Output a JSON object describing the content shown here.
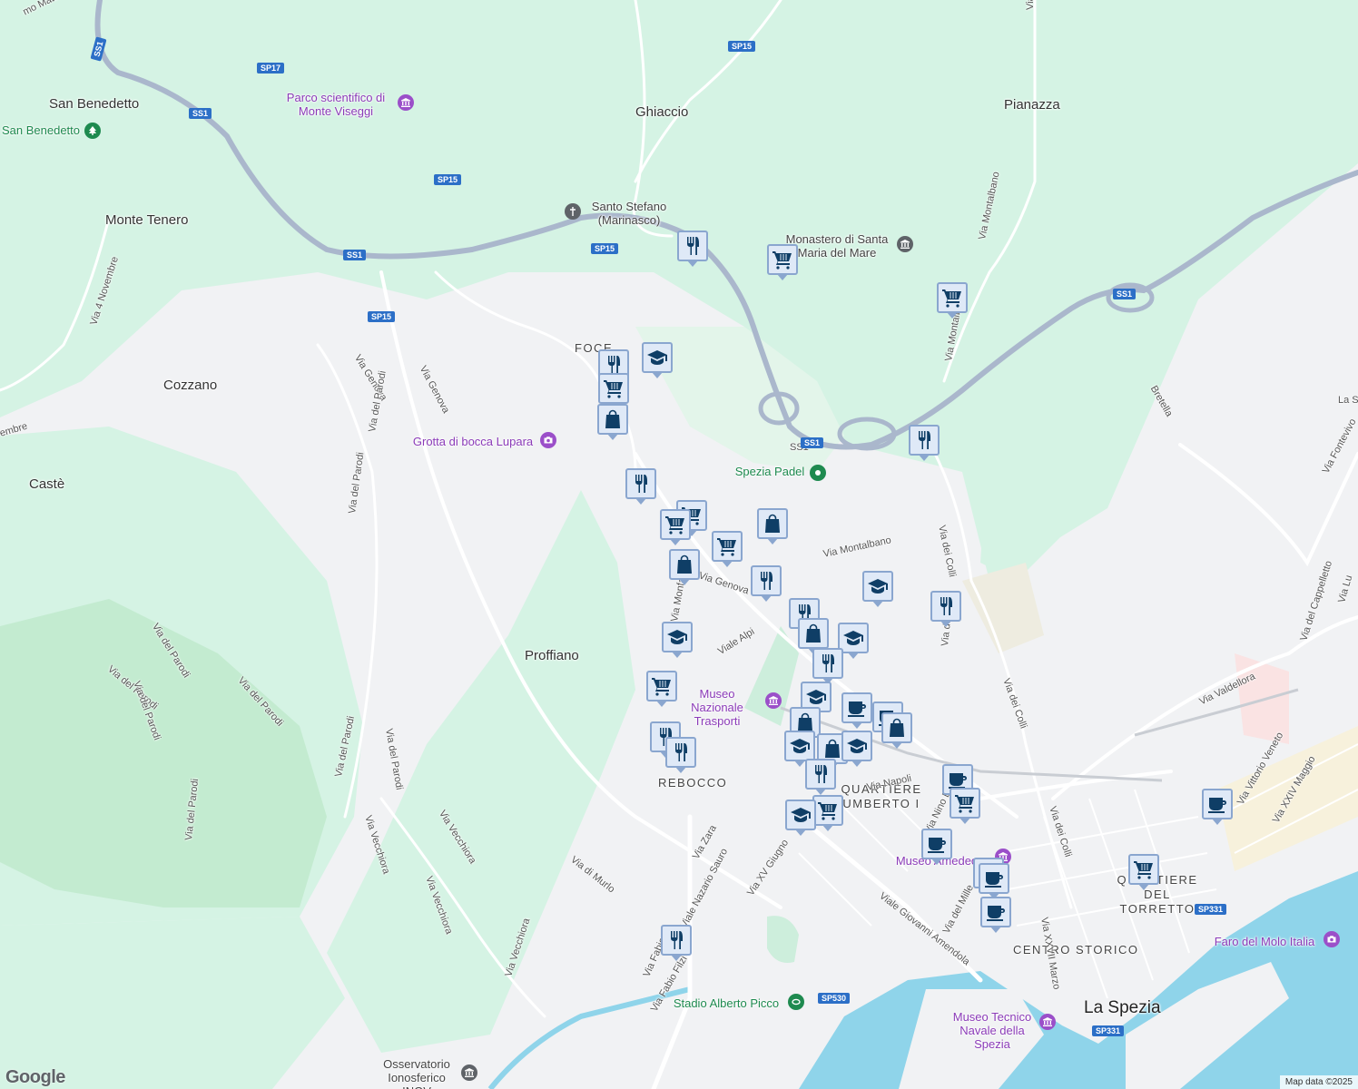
{
  "places": [
    {
      "text": "San Benedetto"
    },
    {
      "text": "Ghiaccio"
    },
    {
      "text": "Pianazza"
    },
    {
      "text": "Monte Tenero"
    },
    {
      "text": "Cozzano"
    },
    {
      "text": "Castè"
    },
    {
      "text": "Proffiano"
    },
    {
      "text": "FOCE"
    },
    {
      "text": "REBOCCO"
    },
    {
      "text": "QUARTIERE UMBERTO I"
    },
    {
      "text": "QUARTIERE DEL TORRETTO"
    },
    {
      "text": "CENTRO STORICO"
    },
    {
      "text": "La Spezia"
    }
  ],
  "pois": [
    {
      "text": "Parco scientifico di Monte Viseggi",
      "icon": "museum-icon",
      "color": "#9b4fc9"
    },
    {
      "text": "San Benedetto",
      "icon": "tree-icon",
      "color": "#1e8a4f"
    },
    {
      "text": "Santo Stefano (Marinasco)",
      "icon": "church-icon",
      "color": "#5f6368"
    },
    {
      "text": "Monastero di Santa Maria del Mare",
      "icon": "landmark-icon",
      "color": "#5f6368"
    },
    {
      "text": "Grotta di bocca Lupara",
      "icon": "camera-icon",
      "color": "#9b4fc9"
    },
    {
      "text": "Spezia Padel",
      "icon": "sport-icon",
      "color": "#1e8a4f"
    },
    {
      "text": "Museo Nazionale Trasporti",
      "icon": "museum-icon",
      "color": "#9b4fc9"
    },
    {
      "text": "Museo Tecnico Navale della Spezia",
      "icon": "museum-icon",
      "color": "#9b4fc9"
    },
    {
      "text": "Faro del Molo Italia",
      "icon": "camera-icon",
      "color": "#9b4fc9"
    },
    {
      "text": "Stadio Alberto Picco",
      "icon": "stadium-icon",
      "color": "#1e8a4f"
    },
    {
      "text": "Osservatorio Ionosferico INGV",
      "icon": "landmark-icon",
      "color": "#5f6368"
    },
    {
      "text": "Museo Amedeo",
      "icon": "museum-icon",
      "color": "#9b4fc9"
    }
  ],
  "streets": [
    "Via Genova",
    "Via Genova",
    "Via del Parodi",
    "Via del Parodi",
    "Via del Parodi",
    "Via del Parodi",
    "Via del Parodi",
    "Via del Parodi",
    "Via del Parodi",
    "Via del Parodi",
    "Via del Parodi",
    "Via Vecchiora",
    "Via Vecchiora",
    "Via Vecchiora",
    "Via Vecchiora",
    "Via 4 Novembre",
    "Via Montalbano",
    "Via Montalbano",
    "Via dei Colli",
    "Via dei Colli",
    "Via dei Colli",
    "Via dei Colli",
    "Viale Alpi",
    "Via Zara",
    "Viale Nazario Sauro",
    "Via XV Giugno",
    "Viale Giovanni Amendola",
    "Via di Murlo",
    "Via Fabio Filzi",
    "Via Fabio",
    "Via Valdellora",
    "Via Vittorio Veneto",
    "Via XXIV Maggio",
    "Via del Cappelletto",
    "Via Nino Bixio",
    "Via del Mille",
    "Via XXVII Marzo",
    "Bretella",
    "Via Fontevivo",
    "Via Genova",
    "Via Monfalcone",
    "SS1",
    "mo Matteotti",
    "Via Montalba",
    "embre",
    "Via Napoli",
    "La S",
    "Via Lu"
  ],
  "shields": [
    "SS1",
    "SP17",
    "SS1",
    "SP15",
    "SP15",
    "SS1",
    "SP15",
    "SP15",
    "SS1",
    "SS1",
    "SP331",
    "SP530",
    "SP331",
    "SP15"
  ],
  "markers": [
    {
      "icon": "restaurant-icon"
    },
    {
      "icon": "cart-icon"
    },
    {
      "icon": "cart-icon"
    },
    {
      "icon": "restaurant-icon"
    },
    {
      "icon": "school-icon"
    },
    {
      "icon": "cart-icon"
    },
    {
      "icon": "shopping-bag-icon"
    },
    {
      "icon": "restaurant-icon"
    },
    {
      "icon": "restaurant-icon"
    },
    {
      "icon": "cart-icon"
    },
    {
      "icon": "cart-icon"
    },
    {
      "icon": "shopping-bag-icon"
    },
    {
      "icon": "cart-icon"
    },
    {
      "icon": "shopping-bag-icon"
    },
    {
      "icon": "restaurant-icon"
    },
    {
      "icon": "school-icon"
    },
    {
      "icon": "restaurant-icon"
    },
    {
      "icon": "restaurant-icon"
    },
    {
      "icon": "shopping-bag-icon"
    },
    {
      "icon": "school-icon"
    },
    {
      "icon": "school-icon"
    },
    {
      "icon": "restaurant-icon"
    },
    {
      "icon": "cart-icon"
    },
    {
      "icon": "school-icon"
    },
    {
      "icon": "cafe-icon"
    },
    {
      "icon": "restaurant-icon"
    },
    {
      "icon": "restaurant-icon"
    },
    {
      "icon": "shopping-bag-icon"
    },
    {
      "icon": "school-icon"
    },
    {
      "icon": "shopping-bag-icon"
    },
    {
      "icon": "school-icon"
    },
    {
      "icon": "cafe-icon"
    },
    {
      "icon": "shopping-bag-icon"
    },
    {
      "icon": "restaurant-icon"
    },
    {
      "icon": "cart-icon"
    },
    {
      "icon": "school-icon"
    },
    {
      "icon": "cafe-icon"
    },
    {
      "icon": "cart-icon"
    },
    {
      "icon": "cafe-icon"
    },
    {
      "icon": "cafe-icon"
    },
    {
      "icon": "cafe-icon"
    },
    {
      "icon": "cafe-icon"
    },
    {
      "icon": "cafe-icon"
    },
    {
      "icon": "cart-icon"
    }
  ],
  "colors": {
    "park": "#d5f3e4",
    "water": "#8fd4ea",
    "land": "#f1f2f4",
    "road": "#ffffff",
    "highway": "#aab7cc",
    "marker_bg": "#dfe9f7",
    "marker_border": "#8aa6cf",
    "marker_icon": "#0f3e66"
  },
  "google": "Google",
  "attribution": "Map data ©2025"
}
